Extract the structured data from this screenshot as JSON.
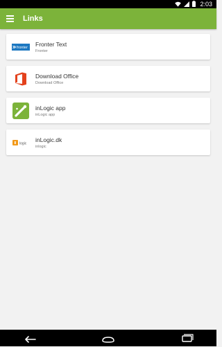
{
  "status_bar": {
    "time": "2:03",
    "icons": [
      "wifi-icon",
      "signal-icon",
      "battery-icon"
    ]
  },
  "app_bar": {
    "title": "Links",
    "menu_icon": "menu-icon",
    "color": "#7cb33a"
  },
  "links": [
    {
      "title": "Fronter Text",
      "subtitle": "Fronter",
      "icon": "fronter-logo",
      "logo_text": "fronter"
    },
    {
      "title": "Download Office",
      "subtitle": "Download Office",
      "icon": "office-logo"
    },
    {
      "title": "inLogic app",
      "subtitle": "inLogic app",
      "icon": "inlogic-app-logo"
    },
    {
      "title": "inLogic.dk",
      "subtitle": "inlogic",
      "icon": "inlogic-logo",
      "logo_text": "logic"
    }
  ],
  "nav_bar": {
    "buttons": [
      "back-icon",
      "home-icon",
      "recents-icon"
    ]
  }
}
